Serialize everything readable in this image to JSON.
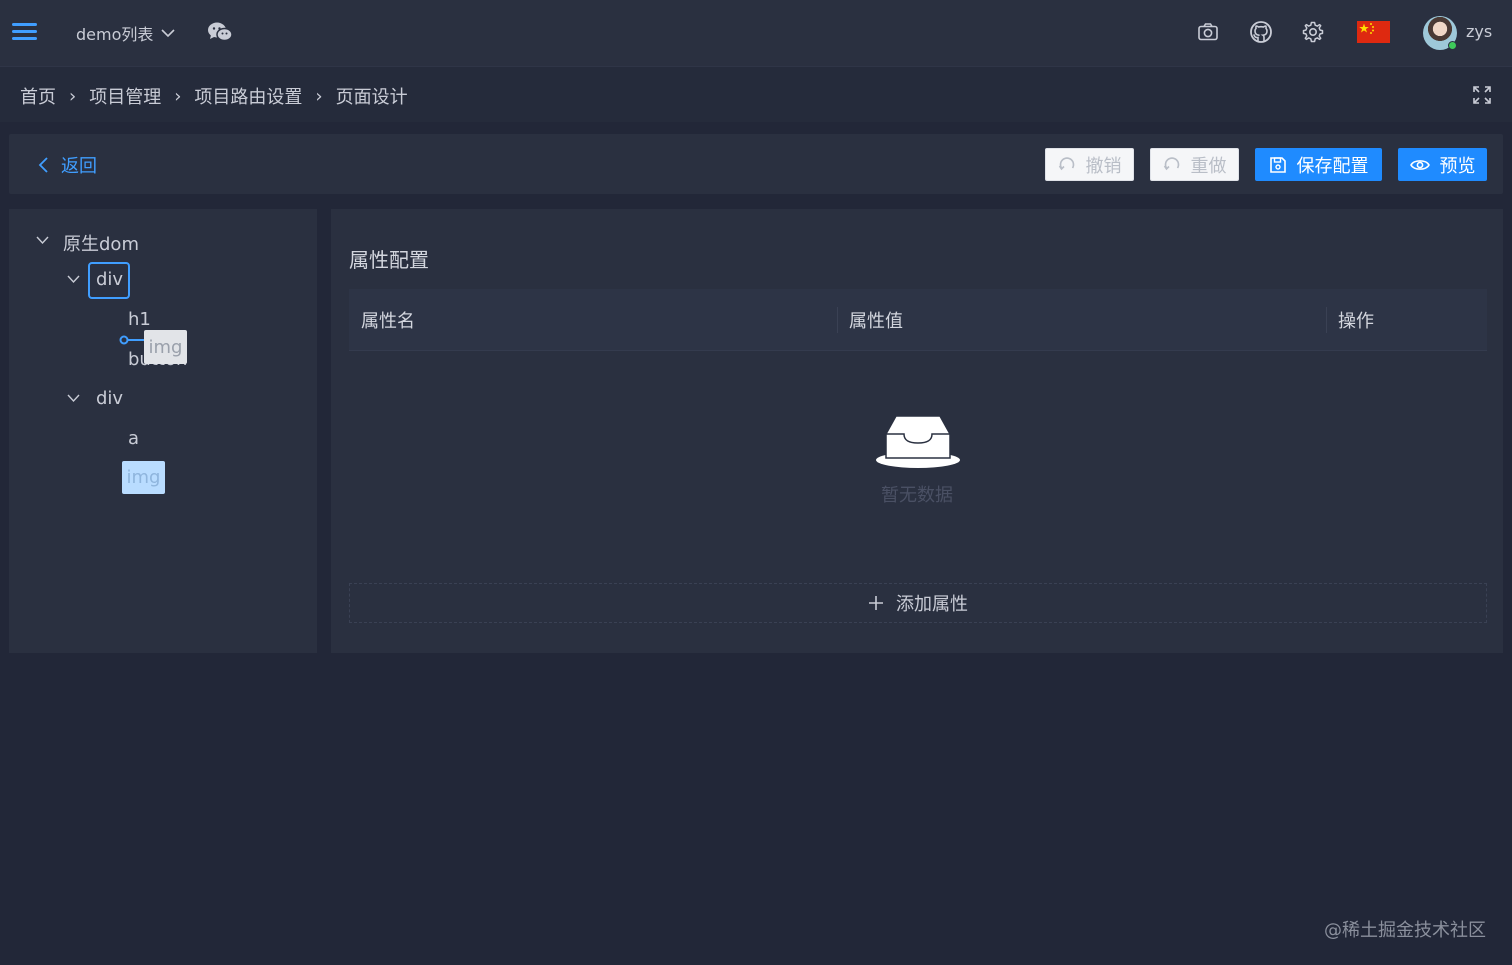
{
  "header": {
    "menu_icon": "hamburger-menu-icon",
    "dropdown_label": "demo列表",
    "dropdown_icon": "chevron-down-icon",
    "wechat_icon": "wechat-icon",
    "tools": [
      "camera-icon",
      "github-icon",
      "gear-icon",
      "china-flag-icon"
    ],
    "username": "zys",
    "accent_color": "#409eff"
  },
  "breadcrumb": {
    "items": [
      "首页",
      "项目管理",
      "项目路由设置",
      "页面设计"
    ],
    "separator": "›",
    "fullscreen_icon": "fullscreen-icon"
  },
  "actions": {
    "back_label": "返回",
    "undo_label": "撤销",
    "redo_label": "重做",
    "save_label": "保存配置",
    "preview_label": "预览",
    "primary_color": "#1f8bff"
  },
  "tree": {
    "root": "原生dom",
    "nodes": [
      "div",
      "h1",
      "button",
      "div",
      "a",
      "img"
    ],
    "drag_ghost_label": "img"
  },
  "props": {
    "title": "属性配置",
    "columns": [
      "属性名",
      "属性值",
      "操作"
    ],
    "empty_text": "暂无数据",
    "add_label": "添加属性"
  },
  "watermark": "@稀土掘金技术社区"
}
